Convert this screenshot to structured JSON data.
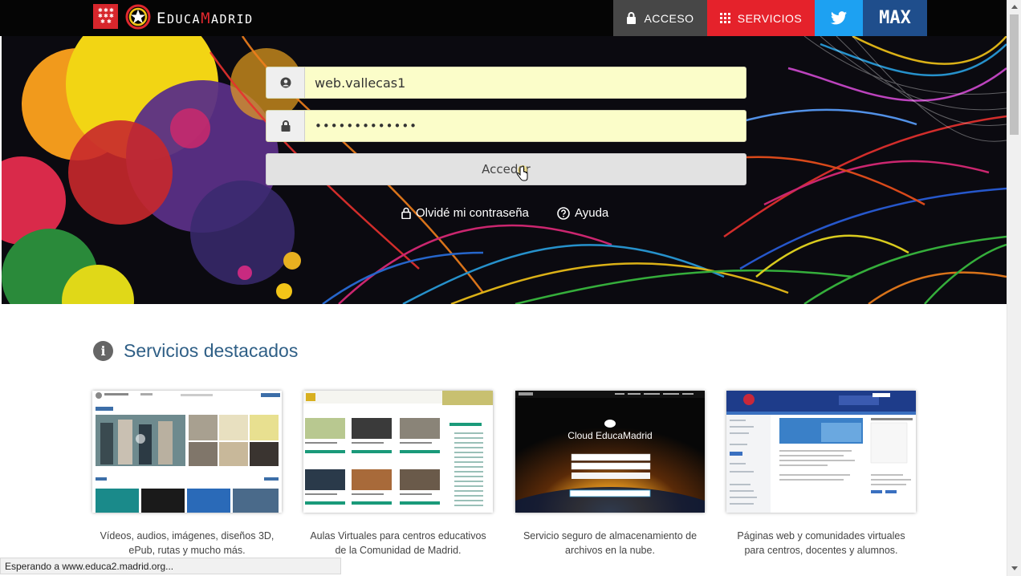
{
  "brand": {
    "name": "EducaMadrid",
    "name_parts": [
      "E",
      "DUCA",
      "M",
      "ADRID"
    ]
  },
  "nav": {
    "acceso": "ACCESO",
    "servicios": "SERVICIOS",
    "max": "MAX"
  },
  "login": {
    "username_value": "web.vallecas1",
    "password_value": "•••••••••••••",
    "submit_label": "Acceder",
    "forgot_label": "Olvidé mi contraseña",
    "help_label": "Ayuda"
  },
  "services": {
    "title": "Servicios destacados",
    "cards": [
      {
        "description": "Vídeos, audios, imágenes, diseños 3D, ePub, rutas y mucho más."
      },
      {
        "description": "Aulas Virtuales para centros educativos de la Comunidad de Madrid."
      },
      {
        "description": "Servicio seguro de almacenamiento de archivos en la nube.",
        "thumb_title": "Cloud EducaMadrid"
      },
      {
        "description": "Páginas web y comunidades virtuales para centros, docentes y alumnos."
      }
    ]
  },
  "status": {
    "text": "Esperando a www.educa2.madrid.org..."
  },
  "colors": {
    "acceso": "#474747",
    "servicios": "#e5222b",
    "twitter": "#1da1f2",
    "max": "#1f4e8c",
    "input_bg": "#fbfdc9",
    "title_blue": "#2f5f86"
  }
}
